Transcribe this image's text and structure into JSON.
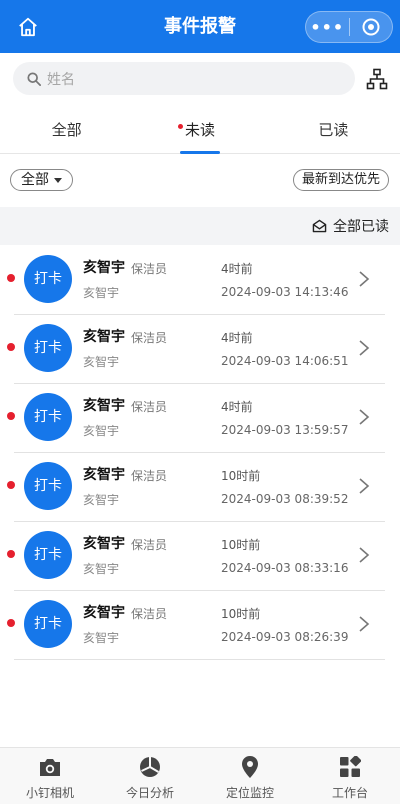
{
  "header": {
    "title": "事件报警",
    "more_label": "•••"
  },
  "search": {
    "placeholder": "姓名"
  },
  "tabs": [
    {
      "label": "全部",
      "active": false,
      "dot": false
    },
    {
      "label": "未读",
      "active": true,
      "dot": true
    },
    {
      "label": "已读",
      "active": false,
      "dot": false
    }
  ],
  "filter": {
    "selected": "全部",
    "sort_label": "最新到达优先"
  },
  "read_all_label": "全部已读",
  "events": [
    {
      "avatar_text": "打卡",
      "name": "亥智宇",
      "role": "保洁员",
      "sub": "亥智宇",
      "ago": "4时前",
      "time": "2024-09-03 14:13:46",
      "unread": true
    },
    {
      "avatar_text": "打卡",
      "name": "亥智宇",
      "role": "保洁员",
      "sub": "亥智宇",
      "ago": "4时前",
      "time": "2024-09-03 14:06:51",
      "unread": true
    },
    {
      "avatar_text": "打卡",
      "name": "亥智宇",
      "role": "保洁员",
      "sub": "亥智宇",
      "ago": "4时前",
      "time": "2024-09-03 13:59:57",
      "unread": true
    },
    {
      "avatar_text": "打卡",
      "name": "亥智宇",
      "role": "保洁员",
      "sub": "亥智宇",
      "ago": "10时前",
      "time": "2024-09-03 08:39:52",
      "unread": true
    },
    {
      "avatar_text": "打卡",
      "name": "亥智宇",
      "role": "保洁员",
      "sub": "亥智宇",
      "ago": "10时前",
      "time": "2024-09-03 08:33:16",
      "unread": true
    },
    {
      "avatar_text": "打卡",
      "name": "亥智宇",
      "role": "保洁员",
      "sub": "亥智宇",
      "ago": "10时前",
      "time": "2024-09-03 08:26:39",
      "unread": true
    }
  ],
  "tabbar": [
    {
      "label": "小钉相机",
      "icon": "camera-icon"
    },
    {
      "label": "今日分析",
      "icon": "pie-chart-icon"
    },
    {
      "label": "定位监控",
      "icon": "location-pin-icon"
    },
    {
      "label": "工作台",
      "icon": "workbench-grid-icon"
    }
  ],
  "colors": {
    "brand": "#1677ea",
    "unread": "#e5202e"
  }
}
